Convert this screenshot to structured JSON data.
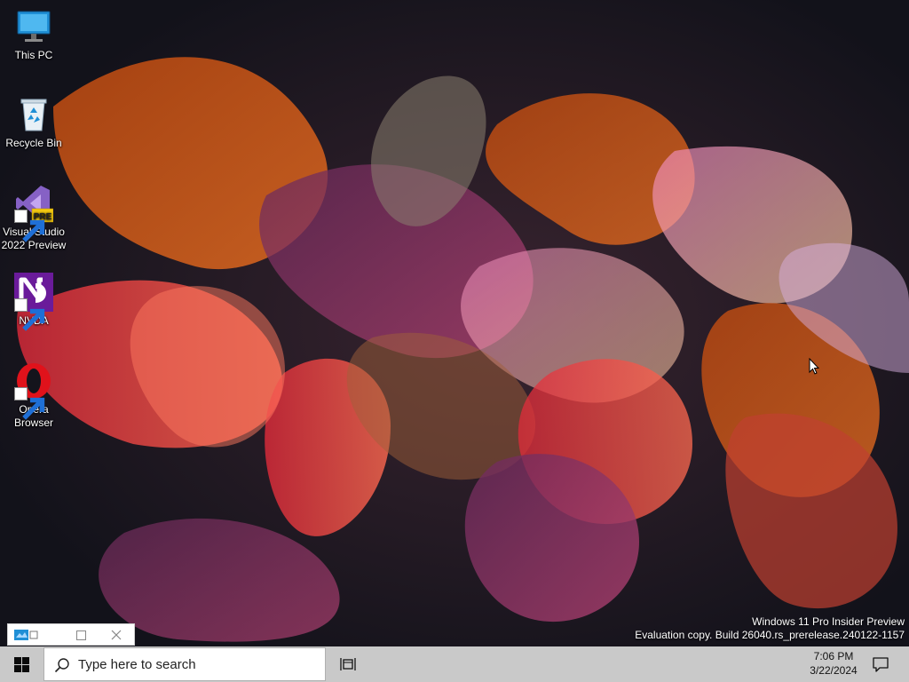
{
  "desktop": {
    "icons": [
      {
        "label": "This PC",
        "icon": "monitor-icon"
      },
      {
        "label": "Recycle Bin",
        "icon": "recycle-bin-icon"
      },
      {
        "label": "Visual Studio 2022 Preview",
        "icon": "visual-studio-icon",
        "badge": "PRE"
      },
      {
        "label": "NVDA",
        "icon": "nvda-icon"
      },
      {
        "label": "Opera Browser",
        "icon": "opera-icon"
      }
    ],
    "watermark": {
      "line1": "Windows 11 Pro Insider Preview",
      "line2": "Evaluation copy. Build 26040.rs_prerelease.240122-1157"
    }
  },
  "mini_window": {
    "icon": "app-window-icon",
    "maximize_icon": "maximize-icon",
    "close_icon": "close-icon"
  },
  "taskbar": {
    "start_icon": "windows-logo-icon",
    "search_placeholder": "Type here to search",
    "search_icon": "search-icon",
    "task_view_icon": "task-view-icon",
    "time": "7:06 PM",
    "date": "3/22/2024",
    "notification_icon": "notification-icon"
  },
  "colors": {
    "taskbar_bg": "#c9c9c9",
    "desktop_bg": "#14141c",
    "windows_blue": "#0067c0",
    "opera_red": "#e0121b",
    "nvda_purple": "#6a1b9a",
    "vs_purple": "#8661c5"
  }
}
